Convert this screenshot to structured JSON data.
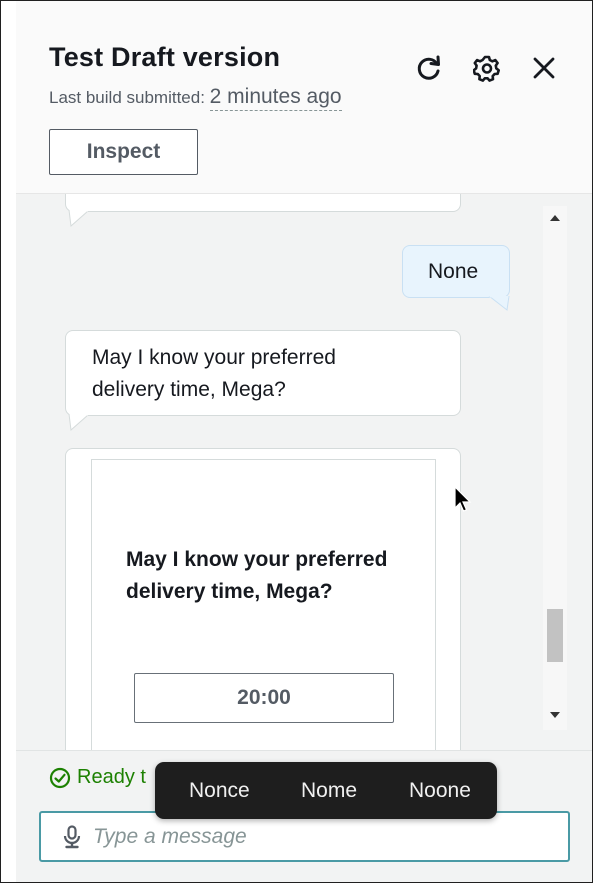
{
  "header": {
    "title": "Test Draft version",
    "build_label": "Last build submitted: ",
    "build_time": "2 minutes ago",
    "inspect_label": "Inspect",
    "icons": [
      "refresh-icon",
      "gear-icon",
      "close-icon"
    ]
  },
  "chat": {
    "messages": [
      {
        "role": "user",
        "text": "None"
      },
      {
        "role": "bot",
        "text": "May I know your preferred delivery time, Mega?"
      }
    ],
    "card": {
      "title": "May I know your preferred delivery time, Mega?",
      "button_label": "20:00"
    }
  },
  "footer": {
    "status_text": "Ready t",
    "input_placeholder": "Type a message",
    "input_value": ""
  },
  "suggestions": [
    "Nonce",
    "Nome",
    "Noone"
  ],
  "colors": {
    "status_green": "#1d8102",
    "input_border": "#4a9aa5",
    "user_bubble": "#e8f4fd",
    "suggestion_bg": "#1e1e1e"
  }
}
